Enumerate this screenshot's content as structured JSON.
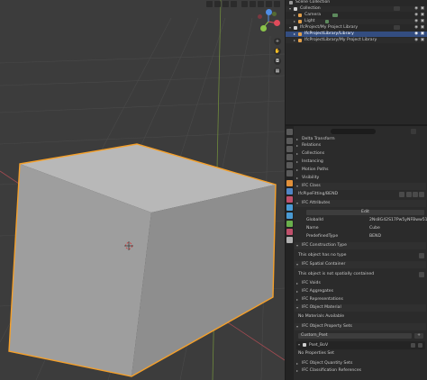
{
  "outliner": {
    "rows": [
      {
        "label": "Scene Collection"
      },
      {
        "label": "Collection"
      },
      {
        "label": "Camera"
      },
      {
        "label": "Light"
      },
      {
        "label": "IfcProject/My Project Library"
      },
      {
        "label": "IfcProjectLibrary/Library"
      },
      {
        "label": "IfcProjectLibrary/My Project Library"
      }
    ]
  },
  "properties": {
    "sections": {
      "delta_transform": "Delta Transform",
      "relations": "Relations",
      "collections": "Collections",
      "instancing": "Instancing",
      "motion_paths": "Motion Paths",
      "visibility": "Visibility",
      "ifc_class": "IFC Class",
      "ifc_class_value": "IfcPipeFitting/BEND",
      "ifc_attributes": "IFC Attributes",
      "edit": "Edit",
      "ifc_construction_type": "IFC Construction Type",
      "no_type": "This object has no type",
      "ifc_spatial_container": "IFC Spatial Container",
      "not_contained": "This object is not spatially contained",
      "ifc_voids": "IFC Voids",
      "ifc_aggregates": "IFC Aggregates",
      "ifc_representations": "IFC Representations",
      "ifc_object_material": "IFC Object Material",
      "no_materials": "No Materials Available",
      "ifc_pset": "IFC Object Property Sets",
      "pset_dropdown": "Custom_Pset",
      "pset_name": "Pset_BoV",
      "no_properties": "No Properties Set",
      "ifc_qset": "IFC Object Quantity Sets",
      "ifc_classification": "IFC Classification References"
    },
    "attributes": [
      {
        "key": "GlobalId",
        "value": "2Ns8G42S17Pw5yNFBww51"
      },
      {
        "key": "Name",
        "value": "Cube"
      },
      {
        "key": "PredefinedType",
        "value": "BEND"
      }
    ]
  },
  "colors": {
    "selection_outline": "#f5a02a",
    "cube_face": "#a9a9a9",
    "axis_x": "#e04b5b",
    "axis_y": "#8bc34a",
    "axis_z": "#4f8ee6"
  }
}
